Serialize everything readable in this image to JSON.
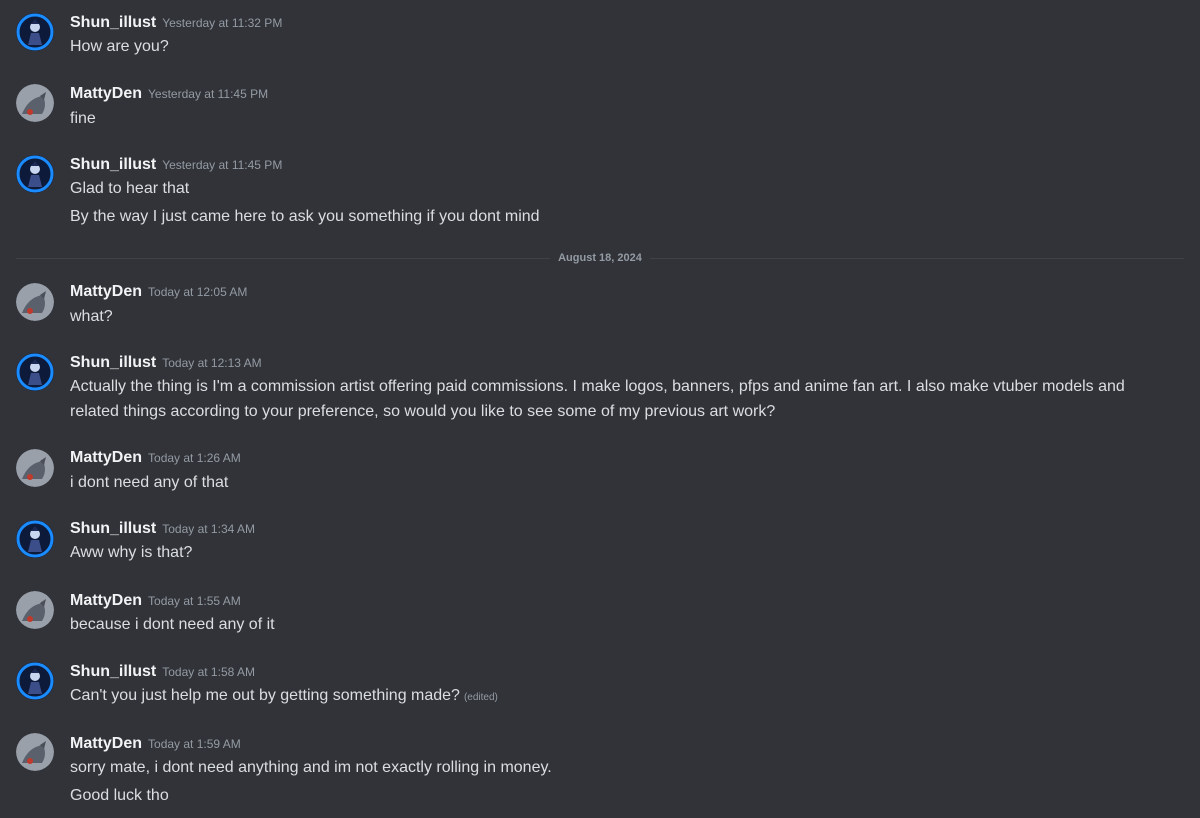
{
  "users": {
    "shun": {
      "name": "Shun_illust",
      "avatar_icon": "anime-character-avatar",
      "avatar_color": "#1466d8"
    },
    "matty": {
      "name": "MattyDen",
      "avatar_icon": "creature-avatar",
      "avatar_color": "#8a8f98"
    }
  },
  "divider": {
    "label": "August 18, 2024"
  },
  "messages": [
    {
      "author": "Shun_illust",
      "timestamp": "Yesterday at 11:32 PM",
      "lines": [
        "How are you?"
      ]
    },
    {
      "author": "MattyDen",
      "timestamp": "Yesterday at 11:45 PM",
      "lines": [
        "fine"
      ]
    },
    {
      "author": "Shun_illust",
      "timestamp": "Yesterday at 11:45 PM",
      "lines": [
        "Glad to hear that",
        "By the way I just came here to ask you something if you dont mind"
      ]
    },
    {
      "author": "MattyDen",
      "timestamp": "Today at 12:05 AM",
      "lines": [
        "what?"
      ]
    },
    {
      "author": "Shun_illust",
      "timestamp": "Today at 12:13 AM",
      "lines": [
        "Actually the thing is I'm a commission artist offering paid commissions. I make logos, banners, pfps and anime fan art. I also make vtuber models and related things according to your preference, so would you like to see some of my previous art work?"
      ]
    },
    {
      "author": "MattyDen",
      "timestamp": "Today at 1:26 AM",
      "lines": [
        "i dont need any of that"
      ]
    },
    {
      "author": "Shun_illust",
      "timestamp": "Today at 1:34 AM",
      "lines": [
        "Aww why is that?"
      ]
    },
    {
      "author": "MattyDen",
      "timestamp": "Today at 1:55 AM",
      "lines": [
        "because i dont need any of it"
      ]
    },
    {
      "author": "Shun_illust",
      "timestamp": "Today at 1:58 AM",
      "lines": [
        "Can't you just help me out by getting something made?"
      ],
      "edited": "(edited)"
    },
    {
      "author": "MattyDen",
      "timestamp": "Today at 1:59 AM",
      "lines": [
        "sorry mate, i dont need anything and im not exactly rolling in money.",
        "Good luck tho"
      ]
    }
  ]
}
